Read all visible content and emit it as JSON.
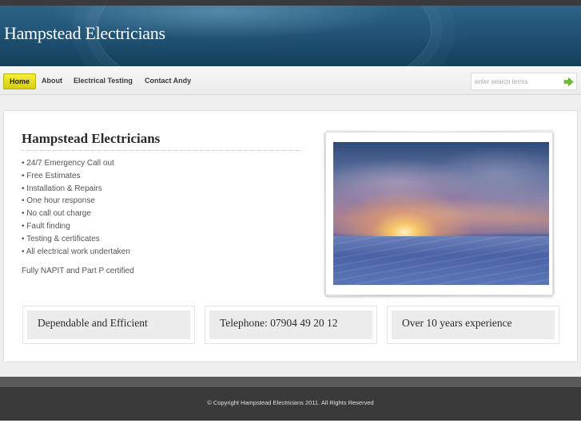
{
  "header": {
    "site_title": "Hampstead Electricians"
  },
  "nav": {
    "items": [
      {
        "label": "Home",
        "active": true
      },
      {
        "label": "About",
        "active": false
      },
      {
        "label": "Electrical Testing",
        "active": false
      },
      {
        "label": "Contact Andy",
        "active": false
      }
    ],
    "active_color": "#e8e020"
  },
  "search": {
    "placeholder": "enter search terms",
    "value": "",
    "go_icon": "arrow-right-icon",
    "icon_color": "#6cbf2a"
  },
  "main": {
    "heading": "Hampstead Electricians",
    "features": [
      "• 24/7 Emergency Call out",
      "• Free Estimates",
      "• Installation & Repairs",
      "• One hour response",
      "• No call out charge",
      "• Fault finding",
      "• Testing & certificates",
      "• All electrical work undertaken"
    ],
    "certification": "Fully NAPIT and Part P certified"
  },
  "boxes": [
    {
      "label": "Dependable and Efficient"
    },
    {
      "label": "Telephone: 07904 49 20 12"
    },
    {
      "label": "Over 10 years experience"
    }
  ],
  "footer": {
    "copyright": "© Copyright Hampstead Electricians 2011. All Rights Reserved"
  },
  "colors": {
    "header_blue": "#1d4f70",
    "footer_dark": "#3a3a3a"
  }
}
